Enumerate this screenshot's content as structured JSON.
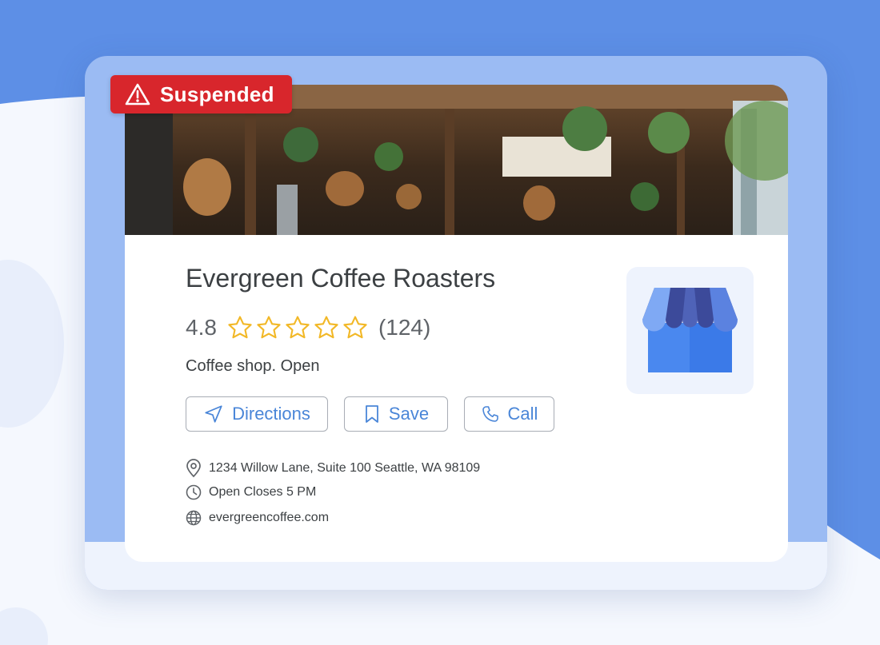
{
  "status_badge": {
    "label": "Suspended",
    "icon": "warning-icon",
    "color": "#d8262c"
  },
  "business": {
    "name": "Evergreen Coffee Roasters",
    "rating": "4.8",
    "stars_total": 5,
    "review_count": "(124)",
    "category": "Coffee shop. Open"
  },
  "actions": {
    "directions": "Directions",
    "save": "Save",
    "call": "Call"
  },
  "details": {
    "address": "1234 Willow Lane, Suite 100 Seattle, WA 98109",
    "hours": "Open Closes 5 PM",
    "website": "evergreencoffee.com"
  },
  "colors": {
    "accent": "#4a86d8",
    "star": "#f2b827",
    "background": "#5d8fe6"
  },
  "logo": {
    "icon": "storefront-icon"
  }
}
